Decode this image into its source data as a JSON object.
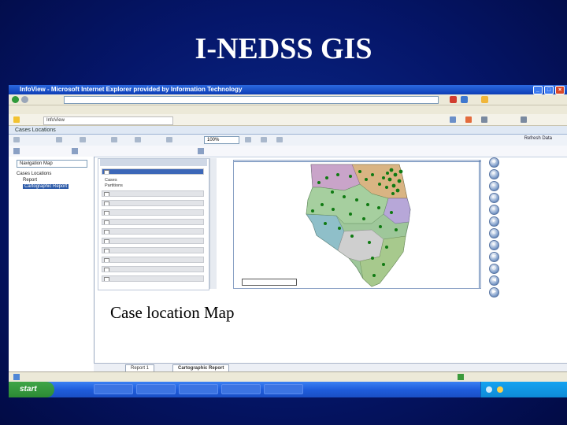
{
  "slide": {
    "title": "I-NEDSS GIS",
    "caption": "Case location Map"
  },
  "browser": {
    "window_title": "InfoView - Microsoft Internet Explorer provided by Information Technology",
    "favorites_tab": "InfoView",
    "app_header": "Cases Locations",
    "zoom_value": "100%",
    "toolbar_right": "Refresh Data"
  },
  "document_tree": {
    "select_value": "Navigation Map",
    "root": "Cases Locations",
    "items": [
      "Report",
      "Cartographic Report"
    ]
  },
  "layers_panel": {
    "legend_items": [
      "Cases",
      "Partitions"
    ]
  },
  "report_tabs": {
    "items": [
      "Report 1",
      "Cartographic Report"
    ]
  },
  "taskbar": {
    "start_label": "start"
  },
  "colors": {
    "slide_background": "#05166a",
    "xp_taskbar": "#1f5ddc",
    "map_case_points": "#1a8a1a"
  }
}
